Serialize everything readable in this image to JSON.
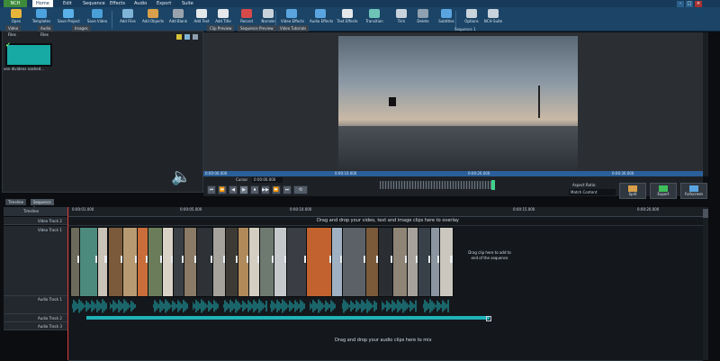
{
  "app": {
    "nch_label": "NCH"
  },
  "menu": {
    "tabs": [
      "Home",
      "Edit",
      "Sequence",
      "Effects",
      "Audio",
      "Export",
      "Suite"
    ],
    "active": "Home"
  },
  "toolbar": {
    "items": [
      {
        "label": "Open",
        "icon": "folder-icon",
        "color": "#e9b43a"
      },
      {
        "label": "Templates",
        "icon": "templates-icon",
        "color": "#4da3e0"
      },
      {
        "label": "Save Project",
        "icon": "save-icon",
        "color": "#5ab0e8"
      },
      {
        "label": "Save Video",
        "icon": "save-video-icon",
        "color": "#4a9fd6"
      },
      {
        "label": "Add Files",
        "icon": "add-files-icon",
        "color": "#7fb4d8"
      },
      {
        "label": "Add Objects",
        "icon": "add-objects-icon",
        "color": "#d8a04a"
      },
      {
        "label": "Add Blank",
        "icon": "add-blank-icon",
        "color": "#9aa3ad"
      },
      {
        "label": "Add Text",
        "icon": "text-icon",
        "color": "#e5e8eb"
      },
      {
        "label": "Add Title",
        "icon": "title-icon",
        "color": "#e5e8eb"
      },
      {
        "label": "Record",
        "icon": "record-icon",
        "color": "#d84a4a"
      },
      {
        "label": "Narrate",
        "icon": "narrate-icon",
        "color": "#c9d3dc"
      },
      {
        "label": "Video Effects",
        "icon": "video-effects-icon",
        "color": "#5aa5e0"
      },
      {
        "label": "Audio Effects",
        "icon": "audio-effects-icon",
        "color": "#5aa5e0"
      },
      {
        "label": "Text Effects",
        "icon": "text-effects-icon",
        "color": "#e5e8eb"
      },
      {
        "label": "Transition",
        "icon": "transition-icon",
        "color": "#6fc4b8"
      },
      {
        "label": "Trim",
        "icon": "trim-icon",
        "color": "#c9d3dc"
      },
      {
        "label": "Delete",
        "icon": "delete-icon",
        "color": "#8fa0b0"
      },
      {
        "label": "Subtitles",
        "icon": "subtitles-icon",
        "color": "#5aa5e0"
      },
      {
        "label": "Options",
        "icon": "options-icon",
        "color": "#c9d3dc"
      },
      {
        "label": "NCH Suite",
        "icon": "suite-icon",
        "color": "#c9d3dc"
      }
    ]
  },
  "bin": {
    "tabs": [
      "Video Files",
      "Audio Files",
      "Images"
    ],
    "file_name": "ven dividens nashed..."
  },
  "preview": {
    "tabs": [
      "Clip Preview",
      "Sequence Preview",
      "Video Tutorials"
    ],
    "sequence_title": "Sequence 1",
    "ruler_times": [
      "0:00:00.000",
      "0:00:10.000",
      "0:00:20.000",
      "0:00:30.000"
    ]
  },
  "transport": {
    "cursor_label": "Cursor",
    "cursor_value": "0:00:00.000",
    "buttons": [
      "⏮",
      "⏪",
      "◀",
      "▶",
      "⏹",
      "▶▶",
      "⏩",
      "⏭",
      "⟲"
    ],
    "aspect_label": "Aspect Ratio:",
    "aspect_value": "Match Content",
    "right_buttons": [
      "Split",
      "Export",
      "Fullscreen"
    ]
  },
  "timeline": {
    "tabs": [
      "Timeline",
      "Sequence 1"
    ],
    "header": "Timeline",
    "times": [
      "0:00:01.000",
      "0:00:05.000",
      "0:00:10.000",
      "0:00:15.000",
      "0:00:20.000"
    ],
    "tracks": {
      "video_track_2": "Video Track 2",
      "video_track_1": "Video Track 1",
      "audio_track_1": "Audio Track 1",
      "audio_track_2": "Audio Track 2",
      "audio_track_3": "Audio Track 3"
    },
    "overlay_hint": "Drag and drop your video, text and image clips here to overlay",
    "end_hint": "Drag clip here to add to end of the sequence",
    "audio_hint": "Drag and drop your audio clips here to mix"
  },
  "colors": {
    "accent": "#1fb2b8",
    "playhead": "#e23b3b",
    "toolbar": "#1b4466"
  }
}
